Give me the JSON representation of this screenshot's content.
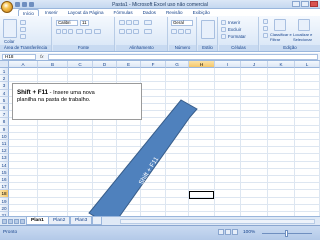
{
  "window": {
    "title": "Pasta1 - Microsoft Excel uso não comercial"
  },
  "ribbon_tabs": [
    "Início",
    "Inserir",
    "Layout da Página",
    "Fórmulas",
    "Dados",
    "Revisão",
    "Exibição"
  ],
  "ribbon": {
    "clipboard": {
      "label": "Área de Transferência",
      "paste": "Colar"
    },
    "font": {
      "label": "Fonte",
      "name": "Calibri",
      "size": "11"
    },
    "alignment": {
      "label": "Alinhamento"
    },
    "number": {
      "label": "Número",
      "format": "Geral"
    },
    "styles": {
      "label": "Estilo"
    },
    "cells": {
      "label": "Células",
      "insert": "Inserir",
      "delete": "Excluir",
      "format": "Formatar"
    },
    "editing": {
      "label": "Edição",
      "sort": "Classificar e Filtrar",
      "find": "Localizar e Selecionar"
    }
  },
  "formula_bar": {
    "name_box": "H18",
    "fx": "fx",
    "value": ""
  },
  "columns": [
    "A",
    "B",
    "C",
    "D",
    "E",
    "F",
    "G",
    "H",
    "I",
    "J",
    "K",
    "L"
  ],
  "rows": [
    "1",
    "2",
    "3",
    "4",
    "5",
    "6",
    "7",
    "8",
    "9",
    "10",
    "11",
    "12",
    "13",
    "14",
    "15",
    "16",
    "17",
    "18",
    "19",
    "20",
    "21"
  ],
  "selected": {
    "column": "H",
    "row": "18"
  },
  "textbox": {
    "title": "Shift + F11",
    "line1": " - Insere uma nova",
    "line2": "planilha na pasta de trabalho."
  },
  "arrow": {
    "label": "Shift + F11",
    "color": "#4f81bd"
  },
  "sheets": [
    "Plan1",
    "Plan2",
    "Plan3"
  ],
  "active_sheet": "Plan1",
  "status": {
    "text": "Pronto",
    "zoom": "100%"
  }
}
